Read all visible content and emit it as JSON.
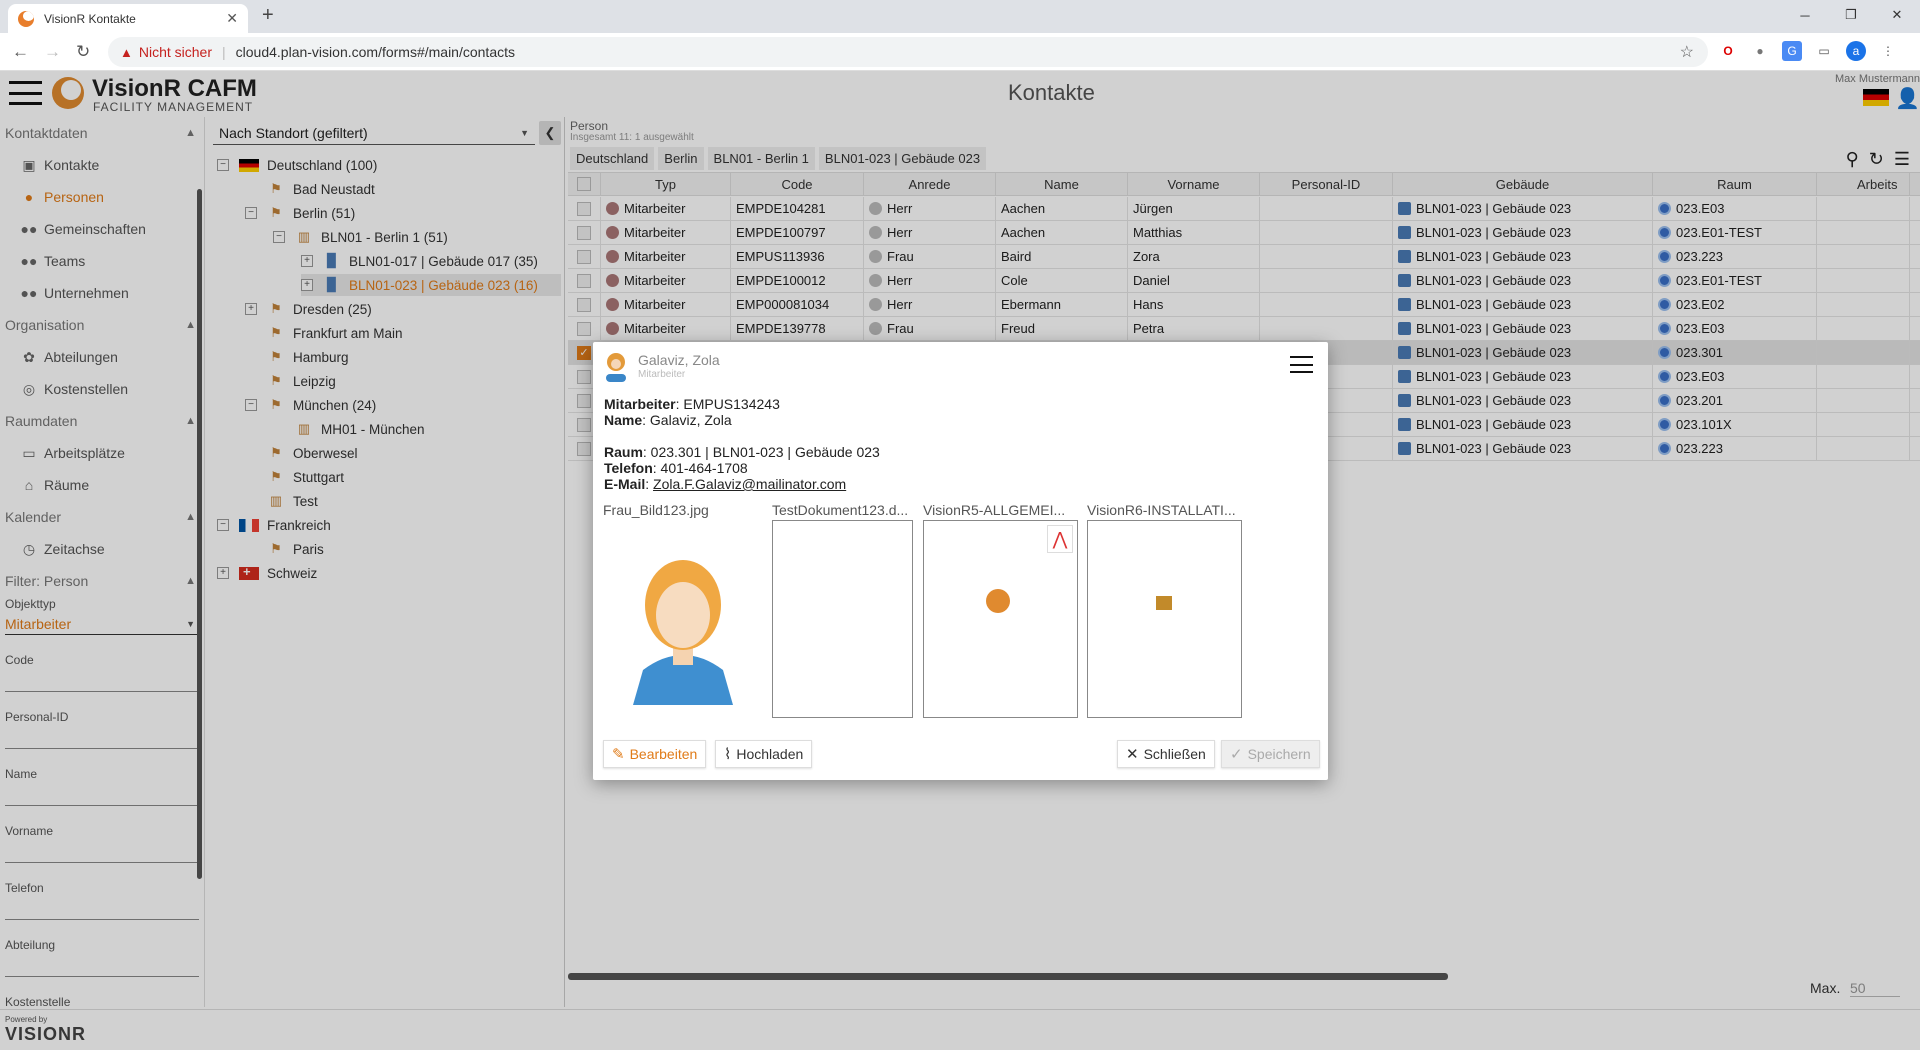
{
  "browser": {
    "tab_title": "VisionR Kontakte",
    "tab_close": "✕",
    "new_tab": "+",
    "security_label": "Nicht sicher",
    "url": "cloud4.plan-vision.com/forms#/main/contacts",
    "profile_letter": "a"
  },
  "app": {
    "brand": "VisionR CAFM",
    "brand_sub": "FACILITY MANAGEMENT",
    "page_title": "Kontakte",
    "user_name": "Max Mustermann",
    "powered_by": "Powered by",
    "footer_logo": "VISIONR"
  },
  "nav": {
    "sec_kontaktdaten": "Kontaktdaten",
    "kontakte": "Kontakte",
    "personen": "Personen",
    "gemeinschaften": "Gemeinschaften",
    "teams": "Teams",
    "unternehmen": "Unternehmen",
    "sec_organisation": "Organisation",
    "abteilungen": "Abteilungen",
    "kostenstellen": "Kostenstellen",
    "sec_raumdaten": "Raumdaten",
    "arbeitsplaetze": "Arbeitsplätze",
    "raeume": "Räume",
    "sec_kalender": "Kalender",
    "zeitachse": "Zeitachse",
    "sec_filter": "Filter: Person",
    "objekttyp_label": "Objekttyp",
    "objekttyp_value": "Mitarbeiter",
    "f_code": "Code",
    "f_personal": "Personal-ID",
    "f_name": "Name",
    "f_vorname": "Vorname",
    "f_telefon": "Telefon",
    "f_abteilung": "Abteilung",
    "f_kostenstelle": "Kostenstelle"
  },
  "tree": {
    "selector": "Nach Standort (gefiltert)",
    "items": {
      "t0": "Deutschland (100)",
      "t1": "Bad Neustadt",
      "t2": "Berlin (51)",
      "t3": "BLN01 - Berlin 1 (51)",
      "t4": "BLN01-017 | Gebäude 017 (35)",
      "t5": "BLN01-023 | Gebäude 023 (16)",
      "t6": "Dresden (25)",
      "t7": "Frankfurt am Main",
      "t8": "Hamburg",
      "t9": "Leipzig",
      "t10": "München (24)",
      "t11": "MH01 - München",
      "t12": "Oberwesel",
      "t13": "Stuttgart",
      "t14": "Test",
      "t15": "Frankreich",
      "t16": "Paris",
      "t17": "Schweiz"
    }
  },
  "grid": {
    "label": "Person",
    "sublabel": "Insgesamt 11: 1 ausgewählt",
    "crumbs": {
      "c0": "Deutschland",
      "c1": "Berlin",
      "c2": "BLN01 - Berlin 1",
      "c3": "BLN01-023 | Gebäude 023"
    },
    "columns": {
      "typ": "Typ",
      "code": "Code",
      "anrede": "Anrede",
      "name": "Name",
      "vorname": "Vorname",
      "personal": "Personal-ID",
      "gebaeude": "Gebäude",
      "raum": "Raum",
      "arbeits": "Arbeits"
    },
    "rows": [
      {
        "typ": "Mitarbeiter",
        "code": "EMPDE104281",
        "anrede": "Herr",
        "name": "Aachen",
        "vorname": "Jürgen",
        "personal": "",
        "gebaeude": "BLN01-023 | Gebäude 023",
        "raum": "023.E03"
      },
      {
        "typ": "Mitarbeiter",
        "code": "EMPDE100797",
        "anrede": "Herr",
        "name": "Aachen",
        "vorname": "Matthias",
        "personal": "",
        "gebaeude": "BLN01-023 | Gebäude 023",
        "raum": "023.E01-TEST"
      },
      {
        "typ": "Mitarbeiter",
        "code": "EMPUS113936",
        "anrede": "Frau",
        "name": "Baird",
        "vorname": "Zora",
        "personal": "",
        "gebaeude": "BLN01-023 | Gebäude 023",
        "raum": "023.223"
      },
      {
        "typ": "Mitarbeiter",
        "code": "EMPDE100012",
        "anrede": "Herr",
        "name": "Cole",
        "vorname": "Daniel",
        "personal": "",
        "gebaeude": "BLN01-023 | Gebäude 023",
        "raum": "023.E01-TEST"
      },
      {
        "typ": "Mitarbeiter",
        "code": "EMP000081034",
        "anrede": "Herr",
        "name": "Ebermann",
        "vorname": "Hans",
        "personal": "",
        "gebaeude": "BLN01-023 | Gebäude 023",
        "raum": "023.E02"
      },
      {
        "typ": "Mitarbeiter",
        "code": "EMPDE139778",
        "anrede": "Frau",
        "name": "Freud",
        "vorname": "Petra",
        "personal": "",
        "gebaeude": "BLN01-023 | Gebäude 023",
        "raum": "023.E03"
      },
      {
        "typ": "",
        "code": "",
        "anrede": "",
        "name": "",
        "vorname": "",
        "personal": "",
        "gebaeude": "BLN01-023 | Gebäude 023",
        "raum": "023.301"
      },
      {
        "typ": "",
        "code": "",
        "anrede": "",
        "name": "",
        "vorname": "",
        "personal": "",
        "gebaeude": "BLN01-023 | Gebäude 023",
        "raum": "023.E03"
      },
      {
        "typ": "",
        "code": "",
        "anrede": "",
        "name": "",
        "vorname": "",
        "personal": "",
        "gebaeude": "BLN01-023 | Gebäude 023",
        "raum": "023.201"
      },
      {
        "typ": "",
        "code": "",
        "anrede": "",
        "name": "",
        "vorname": "",
        "personal": "",
        "gebaeude": "BLN01-023 | Gebäude 023",
        "raum": "023.101X"
      },
      {
        "typ": "",
        "code": "",
        "anrede": "",
        "name": "",
        "vorname": "",
        "personal": "",
        "gebaeude": "BLN01-023 | Gebäude 023",
        "raum": "023.223"
      }
    ],
    "max_label": "Max.",
    "max_value": "50"
  },
  "modal": {
    "name": "Galaviz, Zola",
    "role": "Mitarbeiter",
    "mitarbeiter_label": "Mitarbeiter",
    "mitarbeiter_value": ": EMPUS134243",
    "name_label": "Name",
    "name_value": ": Galaviz, Zola",
    "raum_label": "Raum",
    "raum_value": ": 023.301 | BLN01-023 | Gebäude 023",
    "telefon_label": "Telefon",
    "telefon_value": ": 401-464-1708",
    "email_label": "E-Mail",
    "email_sep": ": ",
    "email_value": "Zola.F.Galaviz@mailinator.com",
    "attachments": {
      "a0": "Frau_Bild123.jpg",
      "a1": "TestDokument123.d...",
      "a2": "VisionR5-ALLGEMEI...",
      "a3": "VisionR6-INSTALLATI..."
    },
    "btn_edit": "Bearbeiten",
    "btn_upload": "Hochladen",
    "btn_close": "Schließen",
    "btn_save": "Speichern"
  },
  "colors": {
    "accent": "#e07b18"
  }
}
